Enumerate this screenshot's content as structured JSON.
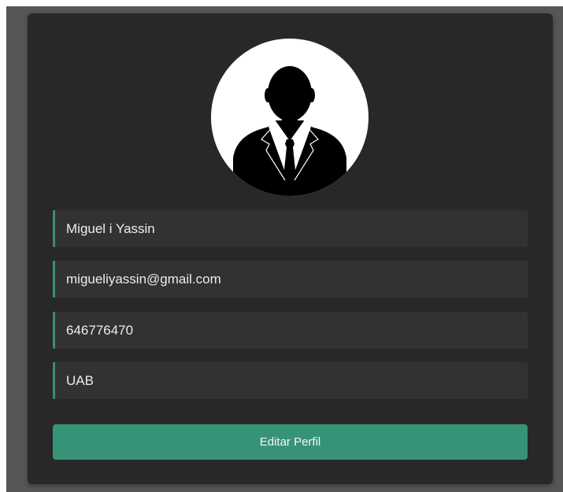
{
  "profile": {
    "avatar_icon": "user-silhouette-icon",
    "name": "Miguel i Yassin",
    "email": "migueliyassin@gmail.com",
    "phone": "646776470",
    "organization": "UAB"
  },
  "actions": {
    "edit_label": "Editar Perfil"
  },
  "colors": {
    "card_background": "#282828",
    "field_background": "#323232",
    "accent": "#379377"
  }
}
